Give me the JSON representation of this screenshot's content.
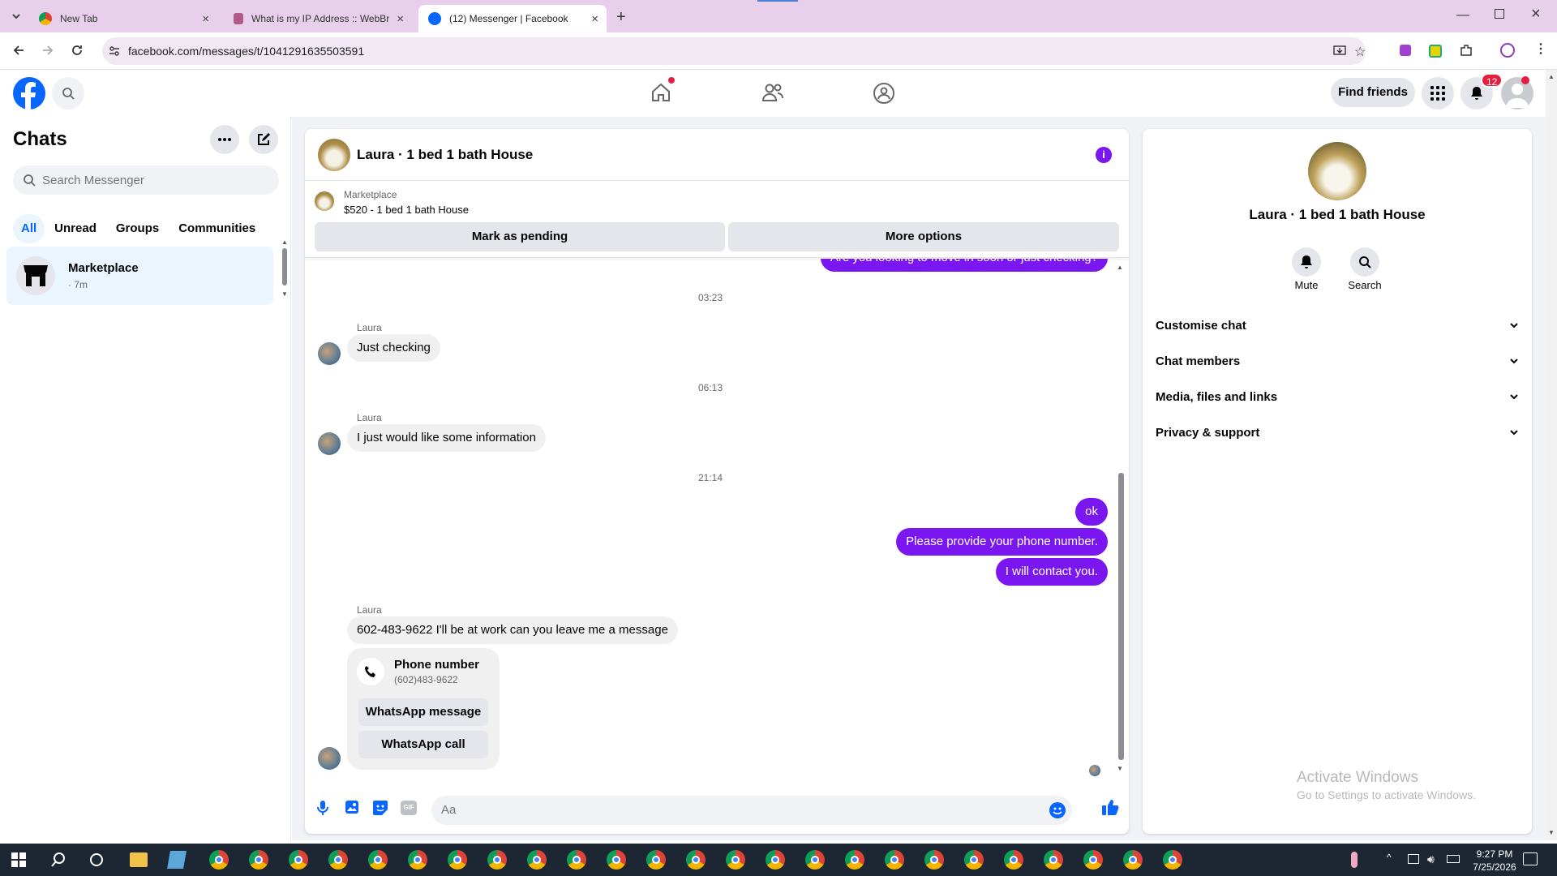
{
  "browser": {
    "tabs": [
      {
        "title": "New Tab",
        "active": false
      },
      {
        "title": "What is my IP Address :: WebBr",
        "active": false
      },
      {
        "title": "(12) Messenger | Facebook",
        "active": true
      }
    ],
    "url": "facebook.com/messages/t/1041291635503591"
  },
  "header": {
    "find_friends": "Find friends",
    "notification_count": "12"
  },
  "chats": {
    "title": "Chats",
    "search_placeholder": "Search Messenger",
    "filters": [
      "All",
      "Unread",
      "Groups",
      "Communities"
    ],
    "items": [
      {
        "name": "Marketplace",
        "meta": "· 7m"
      }
    ]
  },
  "conversation": {
    "title": "Laura · 1 bed 1 bath House",
    "listing_source": "Marketplace",
    "listing_title": "$520 - 1 bed 1 bath House",
    "mark_pending": "Mark as pending",
    "more_options": "More options",
    "cut_message": "Are you looking to move in soon or just checking?",
    "messages": [
      {
        "type": "time",
        "text": "03:23"
      },
      {
        "type": "in",
        "sender": "Laura",
        "text": "Just checking"
      },
      {
        "type": "time",
        "text": "06:13"
      },
      {
        "type": "in",
        "sender": "Laura",
        "text": "I just would like some information"
      },
      {
        "type": "time",
        "text": "21:14"
      },
      {
        "type": "out",
        "text": "ok"
      },
      {
        "type": "out",
        "text": "Please provide your phone number."
      },
      {
        "type": "out",
        "text": "I will contact you."
      },
      {
        "type": "in",
        "sender": "Laura",
        "text": "602-483-9622 I'll be at work can you leave me a message"
      }
    ],
    "phone_card": {
      "label": "Phone number",
      "number": "(602)483-9622",
      "whatsapp_message": "WhatsApp message",
      "whatsapp_call": "WhatsApp call"
    },
    "composer_placeholder": "Aa"
  },
  "info_panel": {
    "name": "Laura · 1 bed 1 bath House",
    "mute": "Mute",
    "search": "Search",
    "sections": [
      "Customise chat",
      "Chat members",
      "Media, files and links",
      "Privacy & support"
    ]
  },
  "watermark": {
    "line1": "Activate Windows",
    "line2": "Go to Settings to activate Windows."
  },
  "taskbar": {
    "time": "9:27 PM",
    "date": "7/25/2026"
  },
  "colors": {
    "messenger_purple": "#7a16f0",
    "facebook_blue": "#0866ff",
    "notification_red": "#e41e3f"
  }
}
